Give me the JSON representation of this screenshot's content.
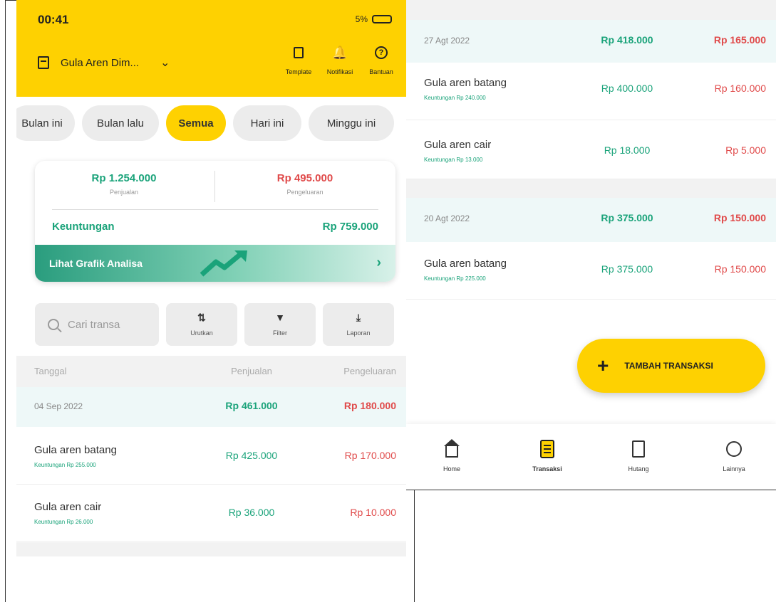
{
  "status": {
    "time": "00:41",
    "right": "5%"
  },
  "header": {
    "store_name": "Gula Aren Dim...",
    "actions": [
      {
        "label": "Template"
      },
      {
        "label": "Notifikasi"
      },
      {
        "label": "Bantuan"
      }
    ]
  },
  "filters": [
    "Bulan ini",
    "Bulan lalu",
    "Semua",
    "Hari ini",
    "Minggu ini"
  ],
  "summary": {
    "sales_value": "Rp 1.254.000",
    "sales_label": "Penjualan",
    "expense_value": "Rp 495.000",
    "expense_label": "Pengeluaran",
    "profit_label": "Keuntungan",
    "profit_value": "Rp 759.000",
    "chart_link": "Lihat Grafik Analisa"
  },
  "tools": {
    "search_placeholder": "Cari transa",
    "sort_label": "Urutkan",
    "filter_label": "Filter",
    "report_label": "Laporan"
  },
  "table": {
    "headers": [
      "Tanggal",
      "Penjualan",
      "Pengeluaran"
    ]
  },
  "left_rows": [
    {
      "date": "04 Sep 2022",
      "sales": "Rp 461.000",
      "expense": "Rp 180.000"
    },
    {
      "name": "Gula aren batang",
      "profit": "Keuntungan Rp 255.000",
      "sales": "Rp 425.000",
      "expense": "Rp 170.000"
    },
    {
      "name": "Gula aren cair",
      "profit": "Keuntungan Rp 26.000",
      "sales": "Rp 36.000",
      "expense": "Rp 10.000"
    }
  ],
  "right_rows": [
    {
      "date": "27 Agt 2022",
      "sales": "Rp 418.000",
      "expense": "Rp 165.000"
    },
    {
      "name": "Gula aren batang",
      "profit": "Keuntungan Rp 240.000",
      "sales": "Rp 400.000",
      "expense": "Rp 160.000"
    },
    {
      "name": "Gula aren cair",
      "profit": "Keuntungan Rp 13.000",
      "sales": "Rp 18.000",
      "expense": "Rp 5.000"
    },
    {
      "date": "20 Agt 2022",
      "sales": "Rp 375.000",
      "expense": "Rp 150.000"
    },
    {
      "name": "Gula aren batang",
      "profit": "Keuntungan Rp 225.000",
      "sales": "Rp 375.000",
      "expense": "Rp 150.000"
    }
  ],
  "fab_label": "TAMBAH TRANSAKSI",
  "bottom_nav": [
    {
      "label": "Home"
    },
    {
      "label": "Transaksi"
    },
    {
      "label": "Hutang"
    },
    {
      "label": "Lainnya"
    }
  ],
  "colors": {
    "brand_yellow": "#fed101",
    "green": "#1aa37a",
    "red": "#e04a4a"
  }
}
